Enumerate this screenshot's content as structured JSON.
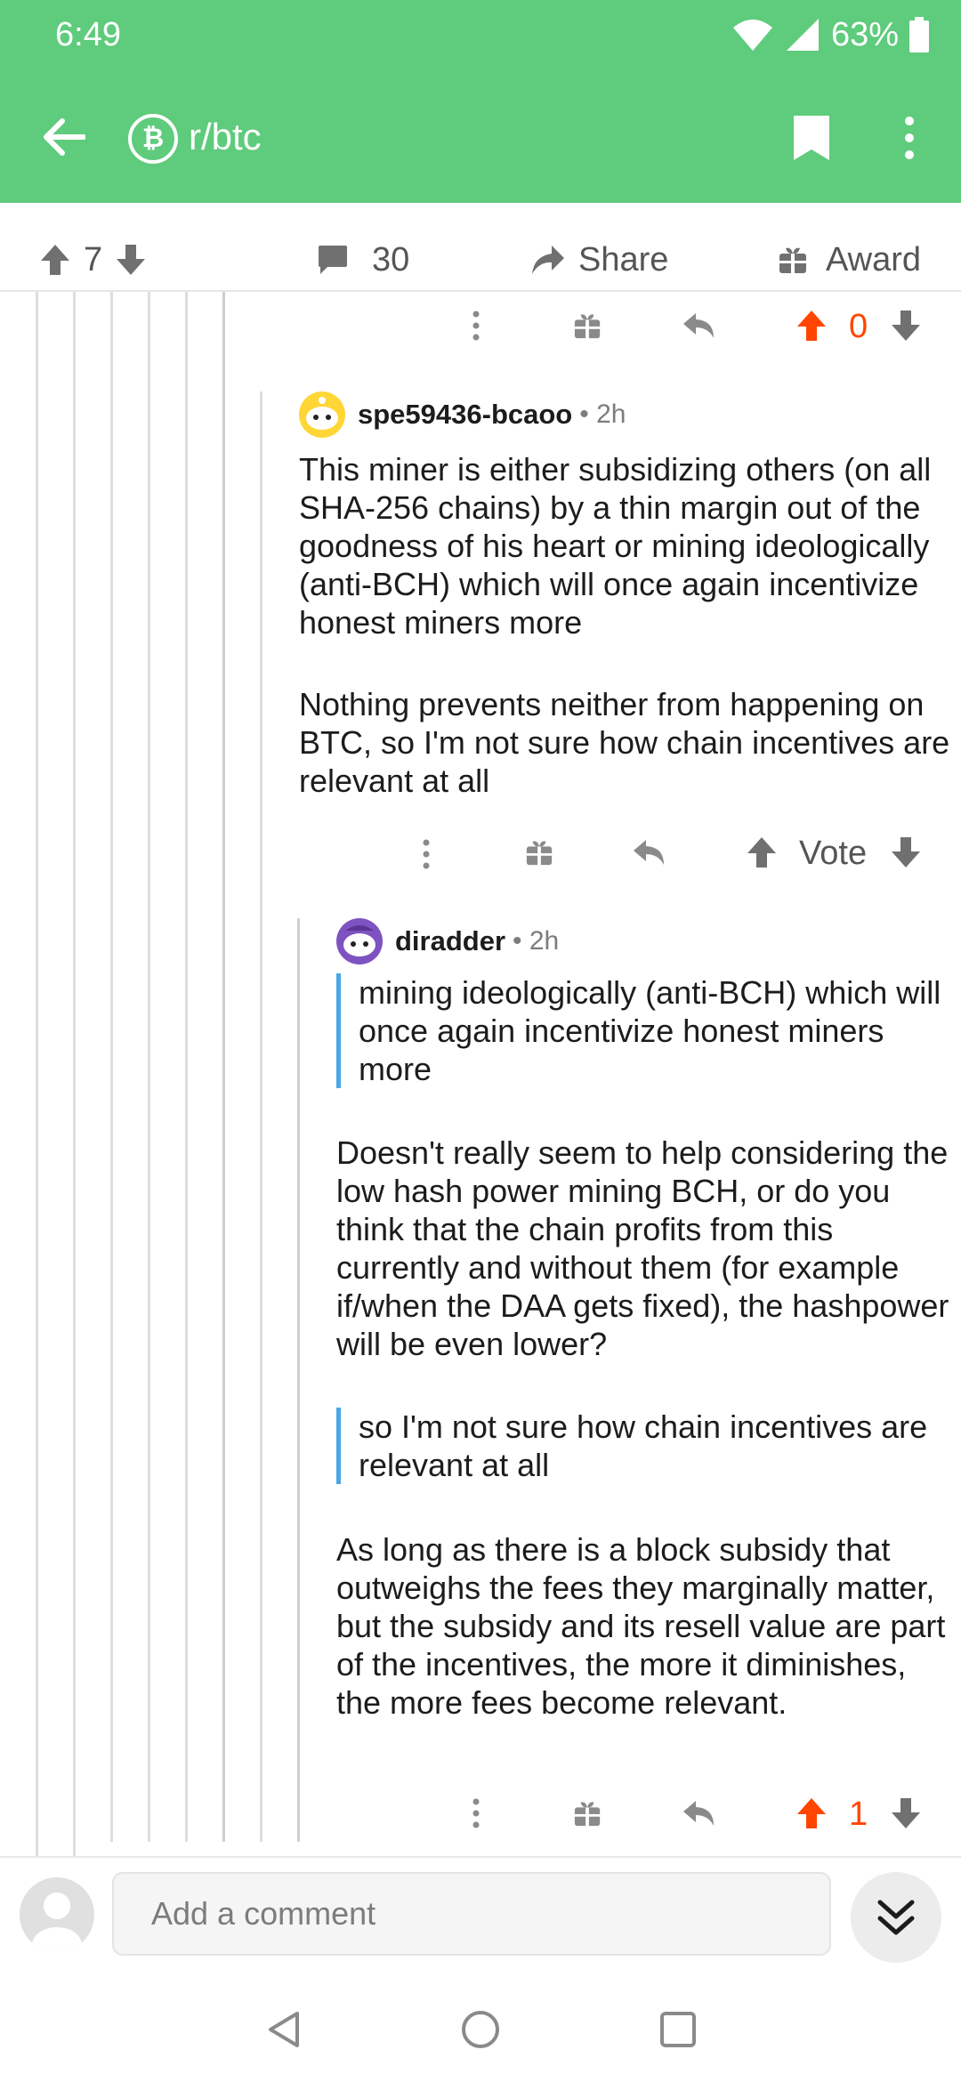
{
  "status": {
    "time": "6:49",
    "battery": "63%"
  },
  "header": {
    "subreddit": "r/btc",
    "sub_icon_glyph": "₿"
  },
  "post_bar": {
    "score": "7",
    "comments": "30",
    "share": "Share",
    "award": "Award"
  },
  "comment_prev": {
    "score": "0"
  },
  "comment1": {
    "author": "spe59436-bcaoo",
    "time": "• 2h",
    "p1": "This miner is either subsidizing others (on all SHA-256 chains) by a thin margin out of the goodness of his heart or mining ideologically (anti-BCH) which will once again incentivize honest miners more",
    "p2": "Nothing prevents neither from happening on BTC, so I'm not sure how chain incentives are relevant at all",
    "vote_label": "Vote"
  },
  "comment2": {
    "author": "diradder",
    "time": "• 2h",
    "quote1": "mining ideologically (anti-BCH) which will once again incentivize honest miners more",
    "p1": "Doesn't really seem to help considering the low hash power mining BCH, or do you think that the chain profits from this currently and without them (for example if/when the DAA gets fixed), the hashpower will be even lower?",
    "quote2": "so I'm not sure how chain incentives are relevant at all",
    "p2": "As long as there is a block subsidy that outweighs the fees they marginally matter, but the subsidy and its resell value are part of the incentives, the more it diminishes, the more fees become relevant.",
    "score": "1"
  },
  "composer": {
    "placeholder": "Add a comment"
  },
  "colors": {
    "header_green": "#5fcb7c",
    "upvote_orange": "#ff4500",
    "quote_blue": "#4aa6e8"
  },
  "icons": [
    "back-arrow-icon",
    "bitcoin-icon",
    "bookmark-icon",
    "more-vert-icon",
    "upvote-icon",
    "downvote-icon",
    "comment-icon",
    "share-icon",
    "gift-icon",
    "reply-icon",
    "chevron-double-down-icon",
    "nav-back-icon",
    "nav-home-icon",
    "nav-recents-icon"
  ]
}
